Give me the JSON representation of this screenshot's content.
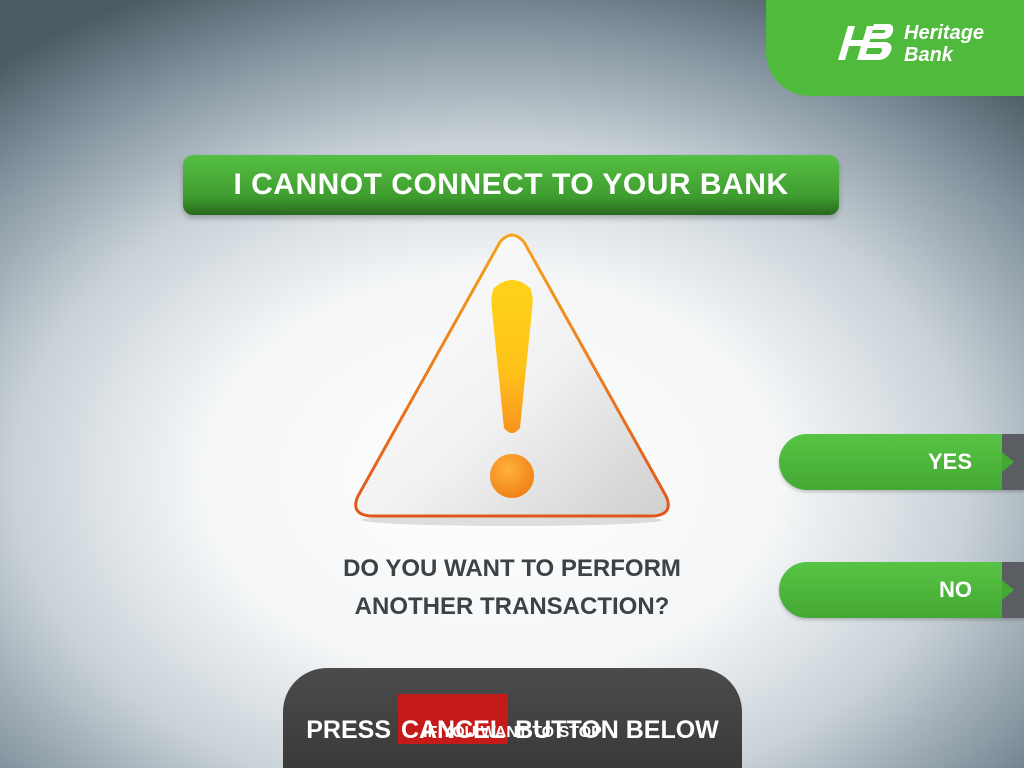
{
  "brand": {
    "name_line1": "Heritage",
    "name_line2": "Bank",
    "monogram": "HB",
    "color": "#4fba3c"
  },
  "title_banner": {
    "text": "I CANNOT CONNECT TO YOUR BANK"
  },
  "warning_icon": {
    "name": "warning-triangle-icon",
    "color": "#f4b12b"
  },
  "question": {
    "line1": "DO YOU WANT TO PERFORM",
    "line2": "ANOTHER TRANSACTION?"
  },
  "buttons": {
    "yes_label": "YES",
    "no_label": "NO"
  },
  "cancel_panel": {
    "prefix": "PRESS",
    "highlight": "CANCEL",
    "suffix": "BUTTON BELOW",
    "subtext": "IF YOU WANT TO STOP",
    "highlight_color": "#c41a1a"
  }
}
